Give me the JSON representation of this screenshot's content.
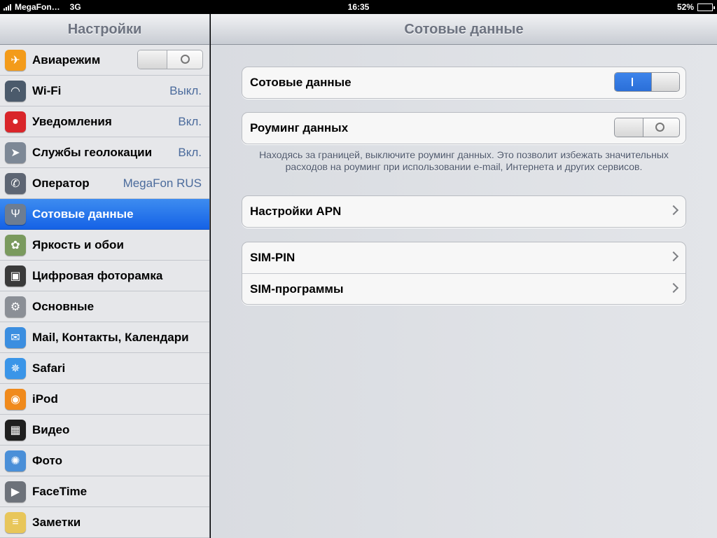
{
  "status_bar": {
    "carrier": "MegaFon…",
    "network": "3G",
    "time": "16:35",
    "battery": "52%",
    "battery_level": 0.52
  },
  "sidebar": {
    "title": "Настройки",
    "items": [
      {
        "label": "Авиарежим",
        "icon": "airplane-icon",
        "color": "#f39b1a",
        "switch": "off"
      },
      {
        "label": "Wi-Fi",
        "value": "Выкл.",
        "icon": "wifi-icon",
        "color": "#4b5a6b"
      },
      {
        "label": "Уведомления",
        "value": "Вкл.",
        "icon": "notifications-icon",
        "color": "#d9252a"
      },
      {
        "label": "Службы геолокации",
        "value": "Вкл.",
        "icon": "location-icon",
        "color": "#7d8896"
      },
      {
        "label": "Оператор",
        "value": "MegaFon RUS",
        "icon": "phone-icon",
        "color": "#5d6573"
      },
      {
        "label": "Сотовые данные",
        "icon": "cellular-icon",
        "color": "#6d7d92",
        "active": true
      },
      {
        "label": "Яркость и обои",
        "icon": "flower-icon",
        "color": "#7a9a5e"
      },
      {
        "label": "Цифровая фоторамка",
        "icon": "photo-frame-icon",
        "color": "#3a3a3a"
      },
      {
        "label": "Основные",
        "icon": "gear-icon",
        "color": "#8b8f96"
      },
      {
        "label": "Mail, Контакты, Календари",
        "icon": "mail-icon",
        "color": "#3b8ee0"
      },
      {
        "label": "Safari",
        "icon": "compass-icon",
        "color": "#3a95e8"
      },
      {
        "label": "iPod",
        "icon": "ipod-icon",
        "color": "#f08a1c"
      },
      {
        "label": "Видео",
        "icon": "clapper-icon",
        "color": "#1f1f1f"
      },
      {
        "label": "Фото",
        "icon": "sunflower-icon",
        "color": "#4a8fd8"
      },
      {
        "label": "FaceTime",
        "icon": "camera-icon",
        "color": "#6d727a"
      },
      {
        "label": "Заметки",
        "icon": "notes-icon",
        "color": "#e8c65a"
      }
    ]
  },
  "main": {
    "title": "Сотовые данные",
    "cellular_data": {
      "label": "Сотовые данные",
      "state": "on"
    },
    "roaming": {
      "label": "Роуминг данных",
      "state": "off"
    },
    "roaming_note": "Находясь за границей, выключите роуминг данных. Это позволит избежать значительных расходов на роуминг при использовании e-mail, Интернета и других сервисов.",
    "apn": {
      "label": "Настройки APN"
    },
    "sim": [
      {
        "label": "SIM-PIN"
      },
      {
        "label": "SIM-программы"
      }
    ]
  }
}
